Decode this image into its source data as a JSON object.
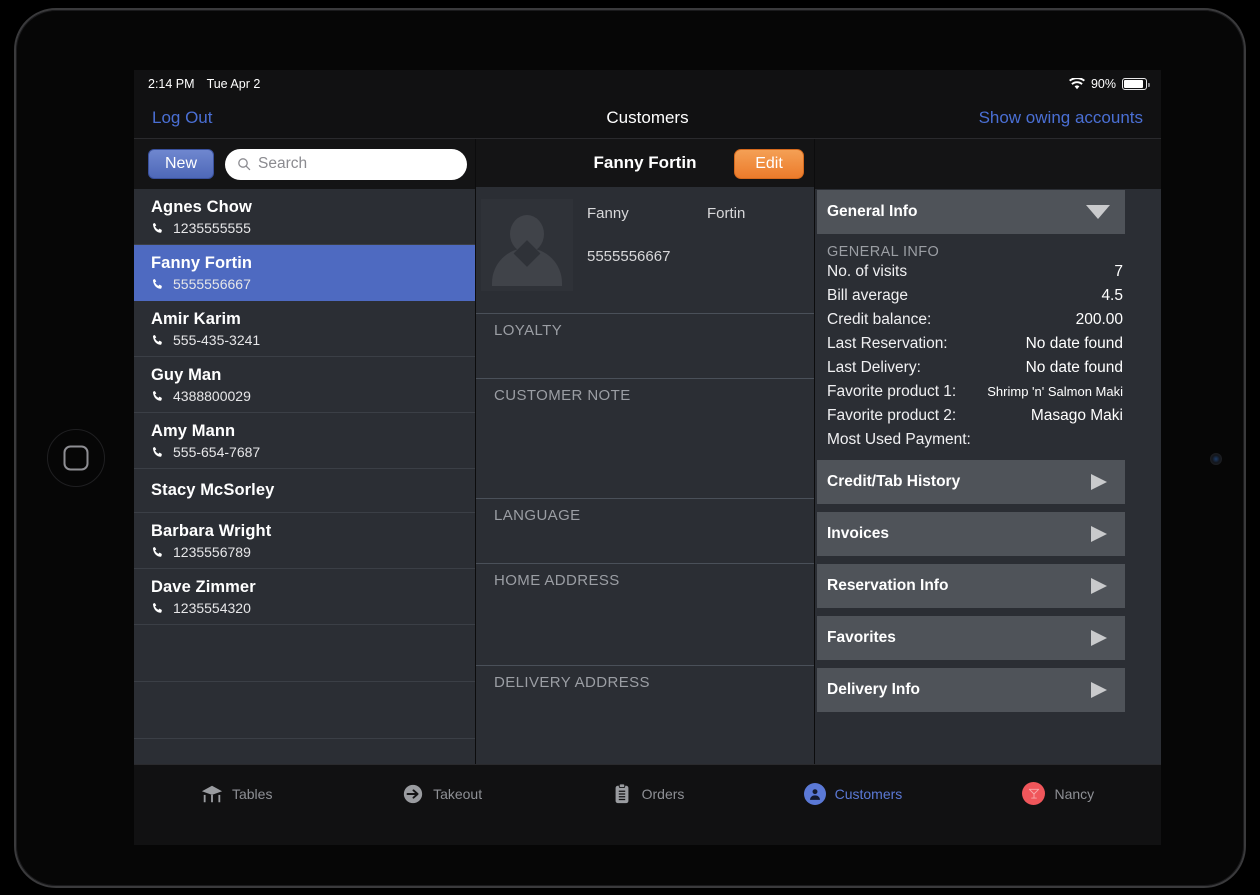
{
  "status_bar": {
    "time": "2:14 PM",
    "date": "Tue Apr 2",
    "battery_percent": "90%",
    "wifi_icon": "wifi-icon",
    "battery_icon": "battery-icon"
  },
  "nav": {
    "logout_label": "Log Out",
    "title": "Customers",
    "show_owing_label": "Show owing accounts",
    "link_color": "#4a6fd4"
  },
  "list_toolbar": {
    "new_label": "New",
    "search_placeholder": "Search",
    "search_value": "",
    "search_icon": "search-icon",
    "new_button_color": "#5a74c4"
  },
  "customer_list": [
    {
      "name": "Agnes Chow",
      "phone": "1235555555",
      "selected": false,
      "has_phone": true
    },
    {
      "name": "Fanny Fortin",
      "phone": "5555556667",
      "selected": true,
      "has_phone": true
    },
    {
      "name": "Amir Karim",
      "phone": "555-435-3241",
      "selected": false,
      "has_phone": true
    },
    {
      "name": "Guy Man",
      "phone": "4388800029",
      "selected": false,
      "has_phone": true
    },
    {
      "name": "Amy Mann",
      "phone": "555-654-7687",
      "selected": false,
      "has_phone": true
    },
    {
      "name": "Stacy McSorley",
      "phone": "",
      "selected": false,
      "has_phone": false
    },
    {
      "name": "Barbara Wright",
      "phone": "1235556789",
      "selected": false,
      "has_phone": true
    },
    {
      "name": "Dave Zimmer",
      "phone": "1235554320",
      "selected": false,
      "has_phone": true
    }
  ],
  "selection_color": "#4e6ac1",
  "detail": {
    "header_name": "Fanny Fortin",
    "edit_label": "Edit",
    "edit_button_color": "#ef8a3c",
    "avatar_icon": "person-placeholder-icon",
    "first_name": "Fanny",
    "last_name": "Fortin",
    "phone": "5555556667",
    "sections": [
      {
        "label": "LOYALTY",
        "value": ""
      },
      {
        "label": "CUSTOMER NOTE",
        "value": ""
      },
      {
        "label": "LANGUAGE",
        "value": ""
      },
      {
        "label": "HOME ADDRESS",
        "value": ""
      },
      {
        "label": "DELIVERY ADDRESS",
        "value": ""
      }
    ]
  },
  "right_panel": {
    "general_info": {
      "header": "General Info",
      "expanded": true,
      "disclosure_icon": "triangle-down-icon",
      "caption": "GENERAL INFO",
      "rows": [
        {
          "key": "No. of visits",
          "value": "7",
          "small": false
        },
        {
          "key": "Bill average",
          "value": "4.5",
          "small": false
        },
        {
          "key": "Credit balance:",
          "value": "200.00",
          "small": false
        },
        {
          "key": "Last Reservation:",
          "value": "No date found",
          "small": false
        },
        {
          "key": "Last Delivery:",
          "value": "No date found",
          "small": false
        },
        {
          "key": "Favorite product 1:",
          "value": "Shrimp 'n' Salmon Maki",
          "small": true
        },
        {
          "key": "Favorite product 2:",
          "value": "Masago Maki",
          "small": false
        },
        {
          "key": "Most Used Payment:",
          "value": "",
          "small": false
        }
      ]
    },
    "collapsed_sections": [
      {
        "header": "Credit/Tab History",
        "disclosure_icon": "triangle-right-icon"
      },
      {
        "header": "Invoices",
        "disclosure_icon": "triangle-right-icon"
      },
      {
        "header": "Reservation Info",
        "disclosure_icon": "triangle-right-icon"
      },
      {
        "header": "Favorites",
        "disclosure_icon": "triangle-right-icon"
      },
      {
        "header": "Delivery Info",
        "disclosure_icon": "triangle-right-icon"
      }
    ],
    "header_bg": "#4f5359"
  },
  "tab_bar": {
    "tabs": [
      {
        "label": "Tables",
        "icon": "table-icon",
        "active": false
      },
      {
        "label": "Takeout",
        "icon": "takeout-icon",
        "active": false
      },
      {
        "label": "Orders",
        "icon": "clipboard-icon",
        "active": false
      },
      {
        "label": "Customers",
        "icon": "person-icon",
        "active": true
      },
      {
        "label": "Nancy",
        "icon": "user-avatar-icon",
        "active": false
      }
    ],
    "active_color": "#5b79d6",
    "avatar_color": "#f0565b"
  }
}
